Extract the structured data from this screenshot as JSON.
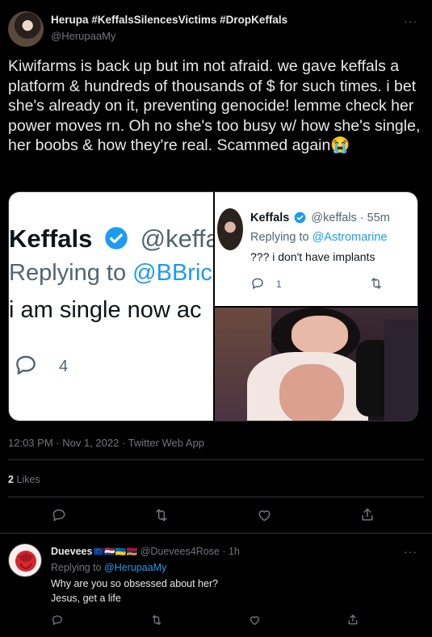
{
  "tweet": {
    "author_name": "Herupa #KeffalsSilencesVictims #DropKeffals",
    "author_handle": "@HerupaaMy",
    "more_label": "···",
    "body": "Kiwifarms is back up but im not afraid. we gave keffals a platform & hundreds of thousands of $ for such times. i bet she's already on it, preventing genocide! lemme check her power moves rn.  Oh no she's too busy w/ how she's single, her boobs & how they're real. Scammed again😭",
    "timestamp": "12:03 PM · Nov 1, 2022 · Twitter Web App",
    "likes_count": "2",
    "likes_label": "Likes"
  },
  "media_left": {
    "name": "Keffals",
    "handle": "@keffa",
    "replying_prefix": "Replying to ",
    "replying_handle": "@BBric",
    "text": "i am single now ac",
    "reply_count": "4"
  },
  "media_right": {
    "name": "Keffals",
    "handle": "@keffals · 55m",
    "replying_prefix": "Replying to ",
    "replying_handle": "@Astromarine",
    "text": "??? i don't have implants",
    "reply_count": "1"
  },
  "reply": {
    "author_name": "Duevees",
    "flags": "🇪🇺🇳🇱🇺🇦🇦🇲",
    "author_handle": "@Duevees4Rose · 1h",
    "more_label": "···",
    "replying_prefix": "Replying to ",
    "replying_handle": "@HerupaaMy",
    "line1": "Why are you so obsessed about her?",
    "line2": "Jesus, get a life"
  },
  "colors": {
    "background": "#000000",
    "text": "#e7e9ea",
    "muted": "#71767b",
    "link": "#1d9bf0",
    "verified": "#1d9bf0",
    "divider": "#2f3336"
  },
  "icons": [
    "reply-icon",
    "retweet-icon",
    "like-icon",
    "share-icon",
    "verified-icon",
    "more-icon"
  ]
}
